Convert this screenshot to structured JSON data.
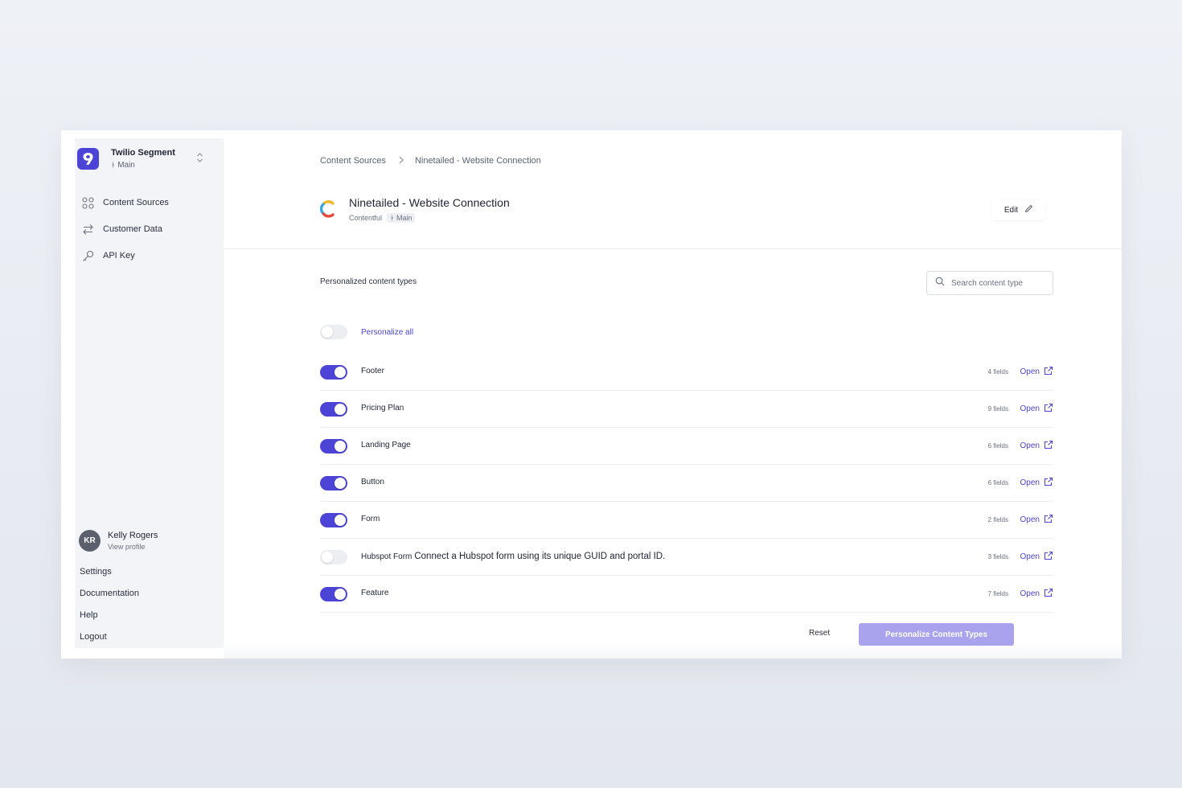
{
  "workspace": {
    "name": "Twilio Segment",
    "branch": "Main"
  },
  "sidebar": {
    "items": [
      {
        "label": "Content Sources",
        "icon": "grid-icon"
      },
      {
        "label": "Customer Data",
        "icon": "arrows-swap-icon"
      },
      {
        "label": "API Key",
        "icon": "key-icon"
      }
    ],
    "profile": {
      "initials": "KR",
      "name": "Kelly Rogers",
      "link": "View profile"
    },
    "bottom_links": [
      "Settings",
      "Documentation",
      "Help",
      "Logout"
    ]
  },
  "breadcrumb": {
    "parent": "Content Sources",
    "current": "Ninetailed - Website Connection"
  },
  "source": {
    "title": "Ninetailed - Website Connection",
    "provider": "Contentful",
    "branch": "Main",
    "edit_label": "Edit"
  },
  "content_types": {
    "section_title": "Personalized content types",
    "search_placeholder": "Search content type",
    "personalize_all_label": "Personalize all",
    "personalize_all_on": false,
    "open_label": "Open",
    "rows": [
      {
        "name": "Footer",
        "description": "",
        "fields": "4 fields",
        "enabled": true
      },
      {
        "name": "Pricing Plan",
        "description": "",
        "fields": "9 fields",
        "enabled": true
      },
      {
        "name": "Landing Page",
        "description": "",
        "fields": "6 fields",
        "enabled": true
      },
      {
        "name": "Button",
        "description": "",
        "fields": "6 fields",
        "enabled": true
      },
      {
        "name": "Form",
        "description": "",
        "fields": "2 fields",
        "enabled": true
      },
      {
        "name": "Hubspot Form",
        "description": "Connect a Hubspot form using its unique GUID and portal ID.",
        "fields": "3 fields",
        "enabled": false
      },
      {
        "name": "Feature",
        "description": "",
        "fields": "7 fields",
        "enabled": true
      }
    ]
  },
  "actions": {
    "reset_label": "Reset",
    "primary_label": "Personalize Content Types"
  },
  "colors": {
    "accent": "#4b44d6",
    "accent_disabled": "#a8a3ec",
    "sidebar_bg": "#f3f4f7"
  }
}
